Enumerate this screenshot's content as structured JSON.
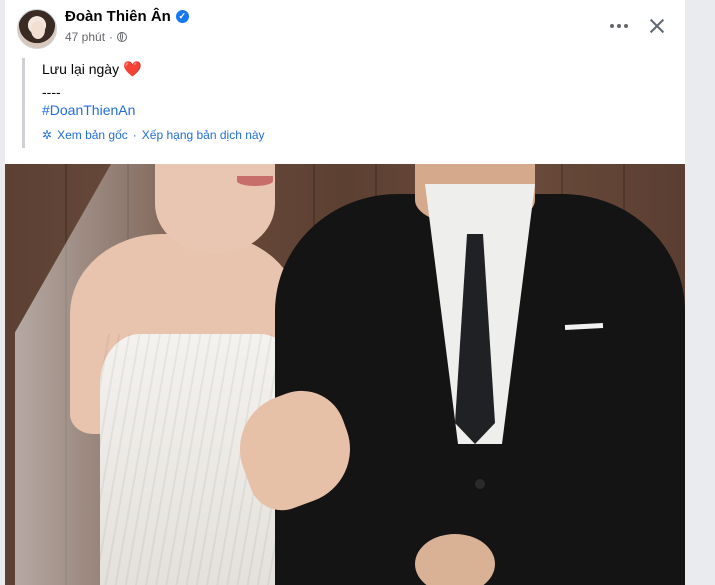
{
  "post": {
    "author": "Đoàn Thiên Ân",
    "time": "47 phút",
    "separator": "·",
    "verified_icon": "verified-badge-icon",
    "privacy_icon": "globe-icon",
    "text_line": "Lưu lại ngày",
    "emoji": "❤️",
    "dashes": "----",
    "hashtag": "#DoanThienAn",
    "translate": {
      "view_original": "Xem bản gốc",
      "dot": "·",
      "rate_translation": "Xếp hạng bản dịch này"
    },
    "image_alt": "wedding-photo"
  },
  "colors": {
    "link": "#216fdb",
    "verified": "#1877f2",
    "secondary_text": "#65676b",
    "heart": "#e41e3f"
  }
}
